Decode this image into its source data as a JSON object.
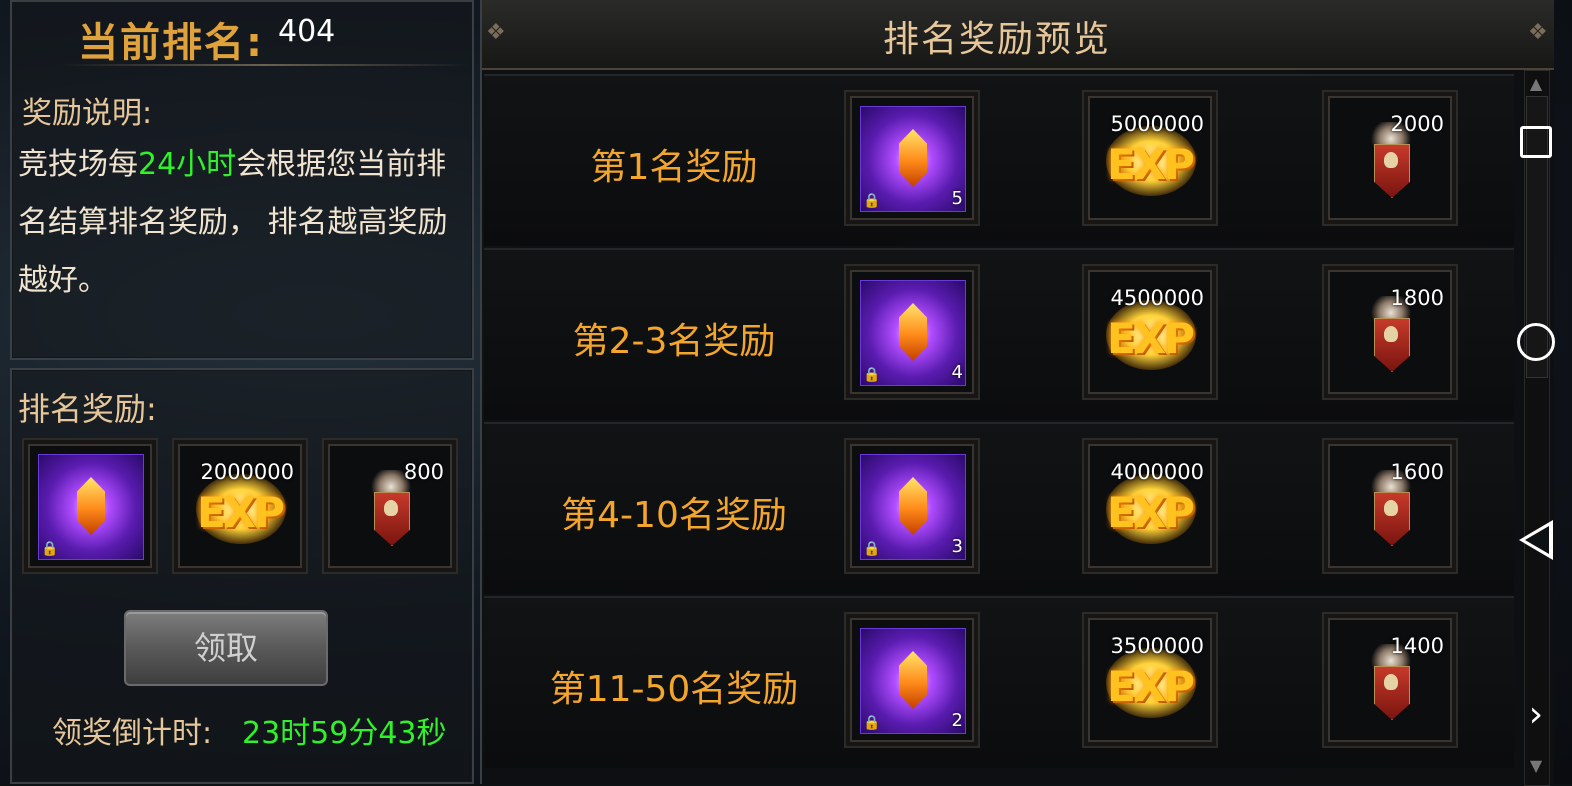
{
  "header": {
    "title": "当前排名:",
    "rank": "404"
  },
  "description": {
    "label": "奖励说明:",
    "text_before": "竞技场每",
    "highlight": "24小时",
    "text_after": "会根据您当前排名结算排名奖励， 排名越高奖励越好。"
  },
  "current_reward": {
    "label": "排名奖励:",
    "gem_count": "",
    "exp_amount": "2000000",
    "badge_amount": "800"
  },
  "claim_button": "领取",
  "countdown": {
    "label": "领奖倒计时:",
    "value": "23时59分43秒"
  },
  "preview": {
    "title": "排名奖励预览",
    "rows": [
      {
        "label": "第1名奖励",
        "gem_count": "5",
        "exp": "5000000",
        "badge": "2000"
      },
      {
        "label": "第2-3名奖励",
        "gem_count": "4",
        "exp": "4500000",
        "badge": "1800"
      },
      {
        "label": "第4-10名奖励",
        "gem_count": "3",
        "exp": "4000000",
        "badge": "1600"
      },
      {
        "label": "第11-50名奖励",
        "gem_count": "2",
        "exp": "3500000",
        "badge": "1400"
      }
    ]
  },
  "icons": {
    "exp_label": "EXP",
    "lock": "lock-icon",
    "gem": "gem-icon",
    "badge": "badge-icon"
  },
  "colors": {
    "accent_orange": "#f4a52b",
    "highlight_green": "#2ff22b",
    "gold_text": "#e7c79a"
  }
}
